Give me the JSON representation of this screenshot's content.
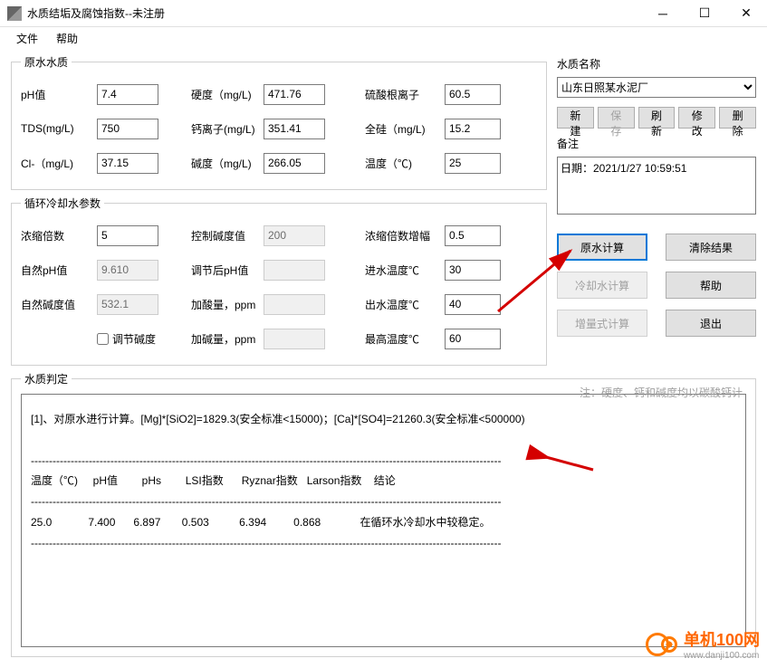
{
  "window": {
    "title": "水质结垢及腐蚀指数--未注册"
  },
  "menu": {
    "file": "文件",
    "help": "帮助"
  },
  "raw_water": {
    "legend": "原水水质",
    "ph_label": "pH值",
    "ph": "7.4",
    "hardness_label": "硬度（mg/L)",
    "hardness": "471.76",
    "sulfate_label": "硫酸根离子",
    "sulfate": "60.5",
    "tds_label": "TDS(mg/L)",
    "tds": "750",
    "calcium_label": "钙离子(mg/L)",
    "calcium": "351.41",
    "silicon_label": "全硅（mg/L)",
    "silicon": "15.2",
    "cl_label": "Cl-（mg/L)",
    "cl": "37.15",
    "alkalinity_label": "碱度（mg/L)",
    "alkalinity": "266.05",
    "temp_label": "温度（℃)",
    "temp": "25"
  },
  "cooling": {
    "legend": "循环冷却水参数",
    "conc_label": "浓缩倍数",
    "conc": "5",
    "control_alk_label": "控制碱度值",
    "control_alk": "200",
    "conc_step_label": "浓缩倍数增幅",
    "conc_step": "0.5",
    "nat_ph_label": "自然pH值",
    "nat_ph": "9.610",
    "adj_ph_label": "调节后pH值",
    "adj_ph": "",
    "inlet_temp_label": "进水温度℃",
    "inlet_temp": "30",
    "nat_alk_label": "自然碱度值",
    "nat_alk": "532.1",
    "acid_label": "加酸量，ppm",
    "acid": "",
    "outlet_temp_label": "出水温度℃",
    "outlet_temp": "40",
    "adjust_alk_label": "调节碱度",
    "base_label": "加碱量，ppm",
    "base": "",
    "max_temp_label": "最高温度℃",
    "max_temp": "60"
  },
  "side": {
    "name_label": "水质名称",
    "name_value": "山东日照某水泥厂",
    "new": "新建",
    "save": "保存",
    "refresh": "刷新",
    "modify": "修改",
    "delete": "删除",
    "notes_label": "备注",
    "notes": "日期：2021/1/27 10:59:51",
    "calc_raw": "原水计算",
    "clear": "清除结果",
    "calc_cooling": "冷却水计算",
    "help": "帮助",
    "calc_incr": "增量式计算",
    "exit": "退出"
  },
  "results": {
    "legend": "水质判定",
    "note": "注：硬度、钙和碱度均以碳酸钙计",
    "text": "[1]、对原水进行计算。[Mg]*[SiO2]=1829.3(安全标准<15000)；[Ca]*[SO4]=21260.3(安全标准<500000)\n\n----------------------------------------------------------------------------------------------------------------------------------\n温度（℃)     pH值        pHs        LSI指数      Ryznar指数   Larson指数    结论\n----------------------------------------------------------------------------------------------------------------------------------\n25.0            7.400      6.897       0.503          6.394         0.868             在循环水冷却水中较稳定。\n----------------------------------------------------------------------------------------------------------------------------------"
  },
  "watermark": {
    "name": "单机100网",
    "url": "www.danji100.com"
  },
  "chart_data": {
    "type": "table",
    "title": "水质判定",
    "columns": [
      "温度（℃)",
      "pH值",
      "pHs",
      "LSI指数",
      "Ryznar指数",
      "Larson指数",
      "结论"
    ],
    "rows": [
      {
        "温度（℃)": 25.0,
        "pH值": 7.4,
        "pHs": 6.897,
        "LSI指数": 0.503,
        "Ryznar指数": 6.394,
        "Larson指数": 0.868,
        "结论": "在循环水冷却水中较稳定。"
      }
    ],
    "annotations": [
      "[Mg]*[SiO2]=1829.3 (安全标准<15000)",
      "[Ca]*[SO4]=21260.3 (安全标准<500000)"
    ]
  }
}
